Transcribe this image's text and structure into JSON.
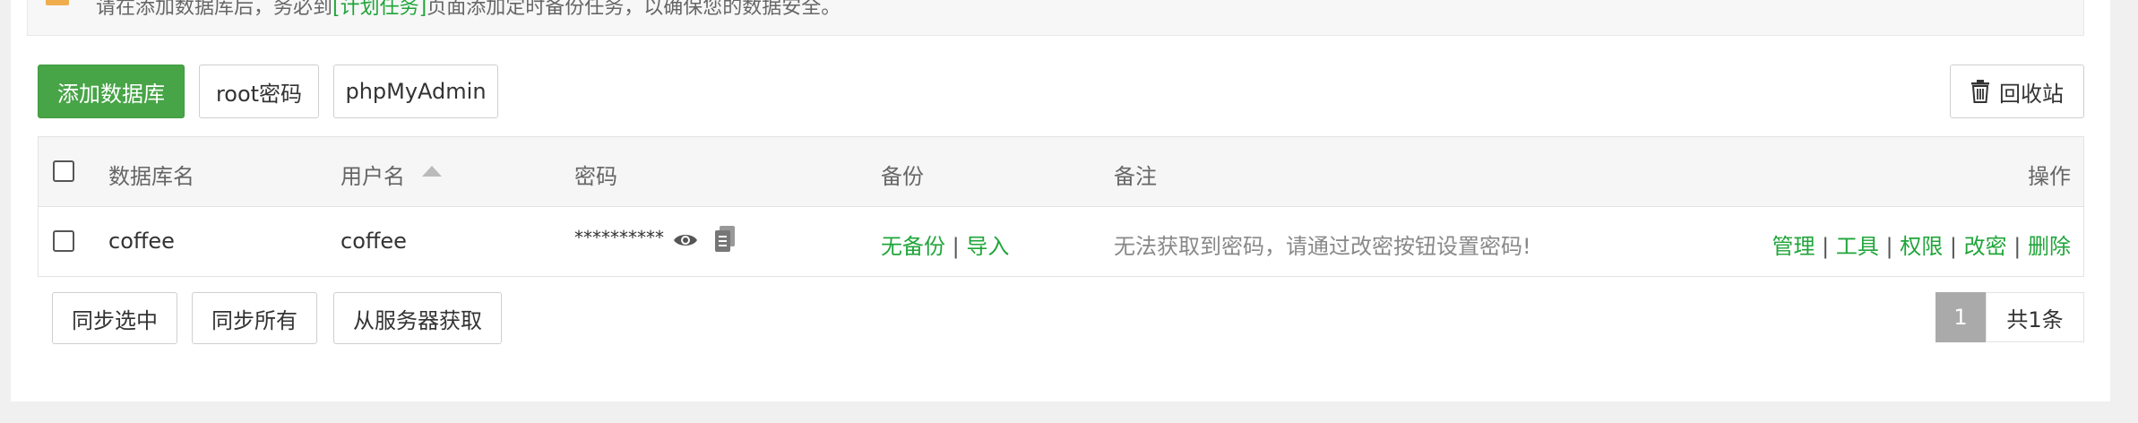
{
  "notice": {
    "text_pre": "请在添加数据库后，务必到",
    "link": "[计划任务]",
    "text_post": "页面添加定时备份任务，以确保您的数据安全。"
  },
  "toolbar": {
    "add_db": "添加数据库",
    "root_pw": "root密码",
    "phpmyadmin": "phpMyAdmin",
    "recycle": "回收站"
  },
  "table": {
    "headers": {
      "name": "数据库名",
      "user": "用户名",
      "password": "密码",
      "backup": "备份",
      "remark": "备注",
      "actions": "操作"
    },
    "rows": [
      {
        "name": "coffee",
        "user": "coffee",
        "password": "**********",
        "backup_none": "无备份",
        "backup_import": "导入",
        "remark": "无法获取到密码，请通过改密按钮设置密码!",
        "act_manage": "管理",
        "act_tools": "工具",
        "act_perm": "权限",
        "act_chpw": "改密",
        "act_delete": "删除"
      }
    ],
    "sep": "|"
  },
  "footer": {
    "sync_selected": "同步选中",
    "sync_all": "同步所有",
    "fetch_server": "从服务器获取"
  },
  "pagination": {
    "current": "1",
    "total": "共1条"
  },
  "colors": {
    "primary": "#47a447",
    "link": "#20a53a",
    "warning": "#f0ad4e"
  },
  "icons": [
    "eye-icon",
    "copy-icon",
    "trash-icon",
    "sort-up-icon"
  ]
}
